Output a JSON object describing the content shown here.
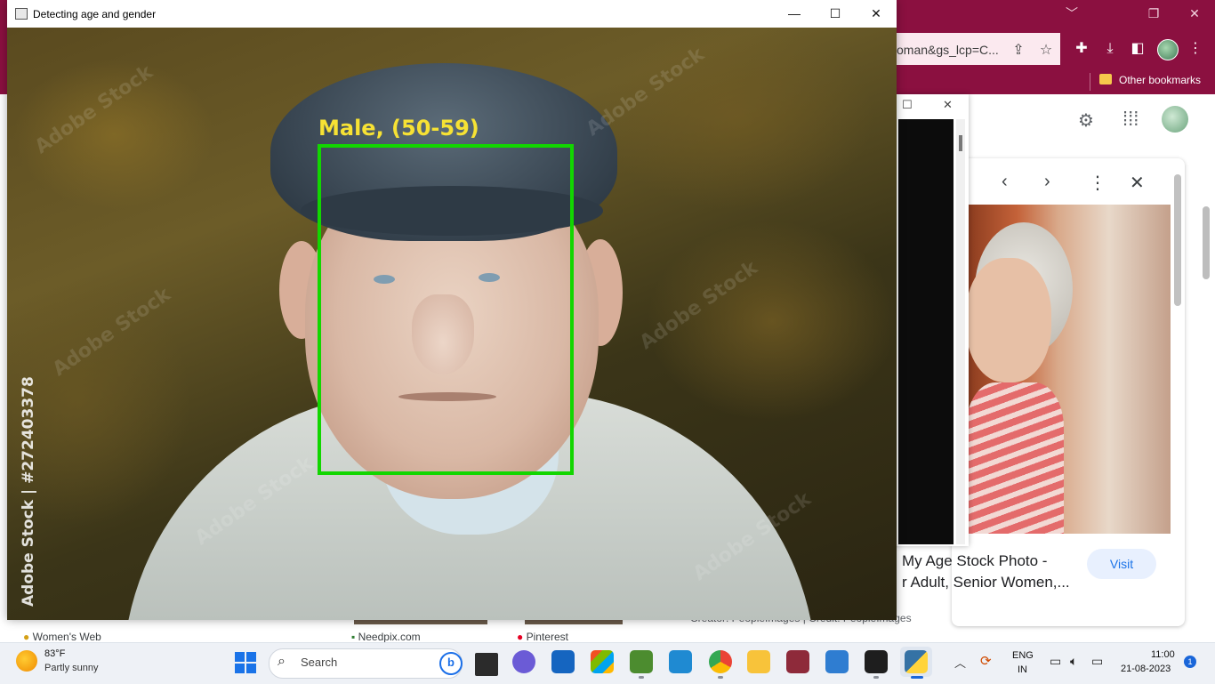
{
  "opencv_window": {
    "title": "Detecting age and gender",
    "minimize_glyph": "—",
    "maximize_glyph": "☐",
    "close_glyph": "✕",
    "detection_label": "Male, (50-59)",
    "box_color": "#12d600",
    "label_color": "#f7e234",
    "watermark_vertical": "Adobe Stock | #272403378",
    "watermark_repeat": "Adobe Stock"
  },
  "chrome": {
    "omnibox_text": "oman&gs_lcp=C...",
    "other_bookmarks": "Other bookmarks",
    "minimize_glyph": "﹀",
    "restore_glyph": "❐",
    "close_glyph": "✕",
    "accent_color": "#8b1040"
  },
  "image_panel": {
    "title_line1": "My Age Stock Photo -",
    "title_line2": "r Adult, Senior Women,...",
    "visit_label": "Visit",
    "credits": "Creator: PeopleImages | Credit: PeopleImages"
  },
  "page_links": {
    "womens_web": "Women's Web",
    "needpix": "Needpix.com",
    "pinterest": "Pinterest"
  },
  "taskbar": {
    "weather_temp": "83°F",
    "weather_desc": "Partly sunny",
    "search_label": "Search",
    "lang_line1": "ENG",
    "lang_line2": "IN",
    "time": "11:00",
    "date": "21-08-2023",
    "notification_count": "1"
  }
}
